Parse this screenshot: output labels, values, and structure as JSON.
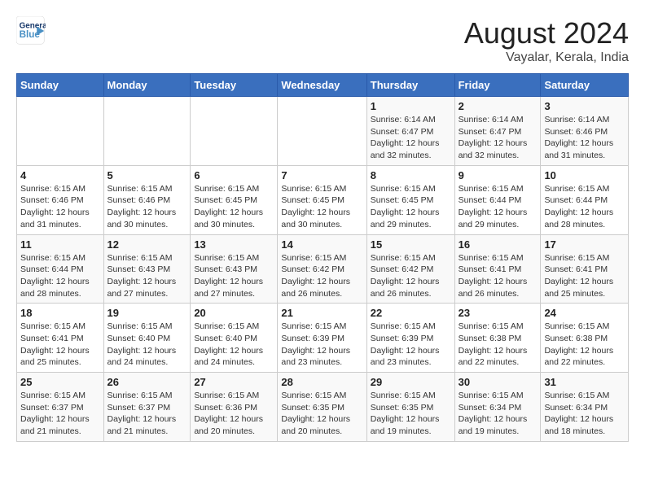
{
  "header": {
    "logo_line1": "General",
    "logo_line2": "Blue",
    "month_year": "August 2024",
    "location": "Vayalar, Kerala, India"
  },
  "weekdays": [
    "Sunday",
    "Monday",
    "Tuesday",
    "Wednesday",
    "Thursday",
    "Friday",
    "Saturday"
  ],
  "weeks": [
    [
      {
        "day": "",
        "info": ""
      },
      {
        "day": "",
        "info": ""
      },
      {
        "day": "",
        "info": ""
      },
      {
        "day": "",
        "info": ""
      },
      {
        "day": "1",
        "info": "Sunrise: 6:14 AM\nSunset: 6:47 PM\nDaylight: 12 hours\nand 32 minutes."
      },
      {
        "day": "2",
        "info": "Sunrise: 6:14 AM\nSunset: 6:47 PM\nDaylight: 12 hours\nand 32 minutes."
      },
      {
        "day": "3",
        "info": "Sunrise: 6:14 AM\nSunset: 6:46 PM\nDaylight: 12 hours\nand 31 minutes."
      }
    ],
    [
      {
        "day": "4",
        "info": "Sunrise: 6:15 AM\nSunset: 6:46 PM\nDaylight: 12 hours\nand 31 minutes."
      },
      {
        "day": "5",
        "info": "Sunrise: 6:15 AM\nSunset: 6:46 PM\nDaylight: 12 hours\nand 30 minutes."
      },
      {
        "day": "6",
        "info": "Sunrise: 6:15 AM\nSunset: 6:45 PM\nDaylight: 12 hours\nand 30 minutes."
      },
      {
        "day": "7",
        "info": "Sunrise: 6:15 AM\nSunset: 6:45 PM\nDaylight: 12 hours\nand 30 minutes."
      },
      {
        "day": "8",
        "info": "Sunrise: 6:15 AM\nSunset: 6:45 PM\nDaylight: 12 hours\nand 29 minutes."
      },
      {
        "day": "9",
        "info": "Sunrise: 6:15 AM\nSunset: 6:44 PM\nDaylight: 12 hours\nand 29 minutes."
      },
      {
        "day": "10",
        "info": "Sunrise: 6:15 AM\nSunset: 6:44 PM\nDaylight: 12 hours\nand 28 minutes."
      }
    ],
    [
      {
        "day": "11",
        "info": "Sunrise: 6:15 AM\nSunset: 6:44 PM\nDaylight: 12 hours\nand 28 minutes."
      },
      {
        "day": "12",
        "info": "Sunrise: 6:15 AM\nSunset: 6:43 PM\nDaylight: 12 hours\nand 27 minutes."
      },
      {
        "day": "13",
        "info": "Sunrise: 6:15 AM\nSunset: 6:43 PM\nDaylight: 12 hours\nand 27 minutes."
      },
      {
        "day": "14",
        "info": "Sunrise: 6:15 AM\nSunset: 6:42 PM\nDaylight: 12 hours\nand 26 minutes."
      },
      {
        "day": "15",
        "info": "Sunrise: 6:15 AM\nSunset: 6:42 PM\nDaylight: 12 hours\nand 26 minutes."
      },
      {
        "day": "16",
        "info": "Sunrise: 6:15 AM\nSunset: 6:41 PM\nDaylight: 12 hours\nand 26 minutes."
      },
      {
        "day": "17",
        "info": "Sunrise: 6:15 AM\nSunset: 6:41 PM\nDaylight: 12 hours\nand 25 minutes."
      }
    ],
    [
      {
        "day": "18",
        "info": "Sunrise: 6:15 AM\nSunset: 6:41 PM\nDaylight: 12 hours\nand 25 minutes."
      },
      {
        "day": "19",
        "info": "Sunrise: 6:15 AM\nSunset: 6:40 PM\nDaylight: 12 hours\nand 24 minutes."
      },
      {
        "day": "20",
        "info": "Sunrise: 6:15 AM\nSunset: 6:40 PM\nDaylight: 12 hours\nand 24 minutes."
      },
      {
        "day": "21",
        "info": "Sunrise: 6:15 AM\nSunset: 6:39 PM\nDaylight: 12 hours\nand 23 minutes."
      },
      {
        "day": "22",
        "info": "Sunrise: 6:15 AM\nSunset: 6:39 PM\nDaylight: 12 hours\nand 23 minutes."
      },
      {
        "day": "23",
        "info": "Sunrise: 6:15 AM\nSunset: 6:38 PM\nDaylight: 12 hours\nand 22 minutes."
      },
      {
        "day": "24",
        "info": "Sunrise: 6:15 AM\nSunset: 6:38 PM\nDaylight: 12 hours\nand 22 minutes."
      }
    ],
    [
      {
        "day": "25",
        "info": "Sunrise: 6:15 AM\nSunset: 6:37 PM\nDaylight: 12 hours\nand 21 minutes."
      },
      {
        "day": "26",
        "info": "Sunrise: 6:15 AM\nSunset: 6:37 PM\nDaylight: 12 hours\nand 21 minutes."
      },
      {
        "day": "27",
        "info": "Sunrise: 6:15 AM\nSunset: 6:36 PM\nDaylight: 12 hours\nand 20 minutes."
      },
      {
        "day": "28",
        "info": "Sunrise: 6:15 AM\nSunset: 6:35 PM\nDaylight: 12 hours\nand 20 minutes."
      },
      {
        "day": "29",
        "info": "Sunrise: 6:15 AM\nSunset: 6:35 PM\nDaylight: 12 hours\nand 19 minutes."
      },
      {
        "day": "30",
        "info": "Sunrise: 6:15 AM\nSunset: 6:34 PM\nDaylight: 12 hours\nand 19 minutes."
      },
      {
        "day": "31",
        "info": "Sunrise: 6:15 AM\nSunset: 6:34 PM\nDaylight: 12 hours\nand 18 minutes."
      }
    ]
  ]
}
